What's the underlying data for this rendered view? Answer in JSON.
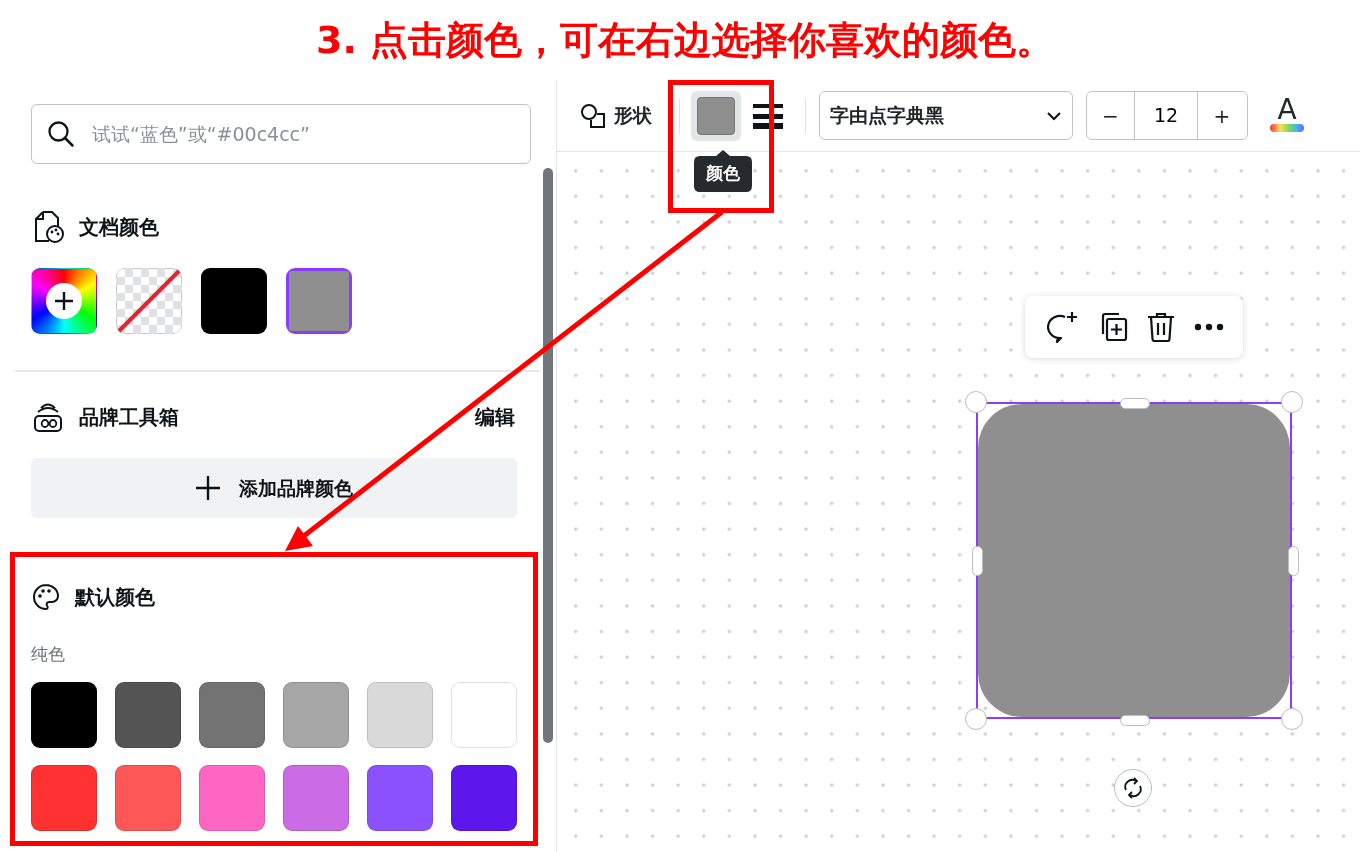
{
  "annotation": {
    "title": "3. 点击颜色，可在右边选择你喜欢的颜色。"
  },
  "color_panel": {
    "search": {
      "placeholder": "试试“蓝色”或“#00c4cc”"
    },
    "document_colors": {
      "title": "文档颜色",
      "swatches": [
        {
          "kind": "add",
          "selected": false
        },
        {
          "kind": "transparent",
          "selected": false
        },
        {
          "kind": "color",
          "color": "#000000",
          "selected": false
        },
        {
          "kind": "color",
          "color": "#8f8f8f",
          "selected": true
        }
      ]
    },
    "brand_kit": {
      "title": "品牌工具箱",
      "edit": "编辑",
      "add_button": "添加品牌颜色"
    },
    "default_colors": {
      "title": "默认颜色",
      "subtitle": "纯色",
      "swatches": [
        {
          "color": "#000000"
        },
        {
          "color": "#545454"
        },
        {
          "color": "#737373"
        },
        {
          "color": "#a6a6a6"
        },
        {
          "color": "#d9d9d9"
        },
        {
          "color": "#ffffff"
        },
        {
          "color": "#ff3131"
        },
        {
          "color": "#ff5757"
        },
        {
          "color": "#ff66c4"
        },
        {
          "color": "#cb6ce6"
        },
        {
          "color": "#8c52ff"
        },
        {
          "color": "#5e17eb"
        }
      ]
    }
  },
  "toolbar": {
    "shape_label": "形状",
    "color_button": {
      "color": "#8f8f8f",
      "selected": true,
      "tooltip": "颜色"
    },
    "font": "字由点字典黑",
    "font_size": {
      "minus": "−",
      "value": "12",
      "plus": "+"
    },
    "text_color_label": "A"
  },
  "canvas": {
    "shape": {
      "color": "#8f8f8f",
      "selected": true
    }
  }
}
